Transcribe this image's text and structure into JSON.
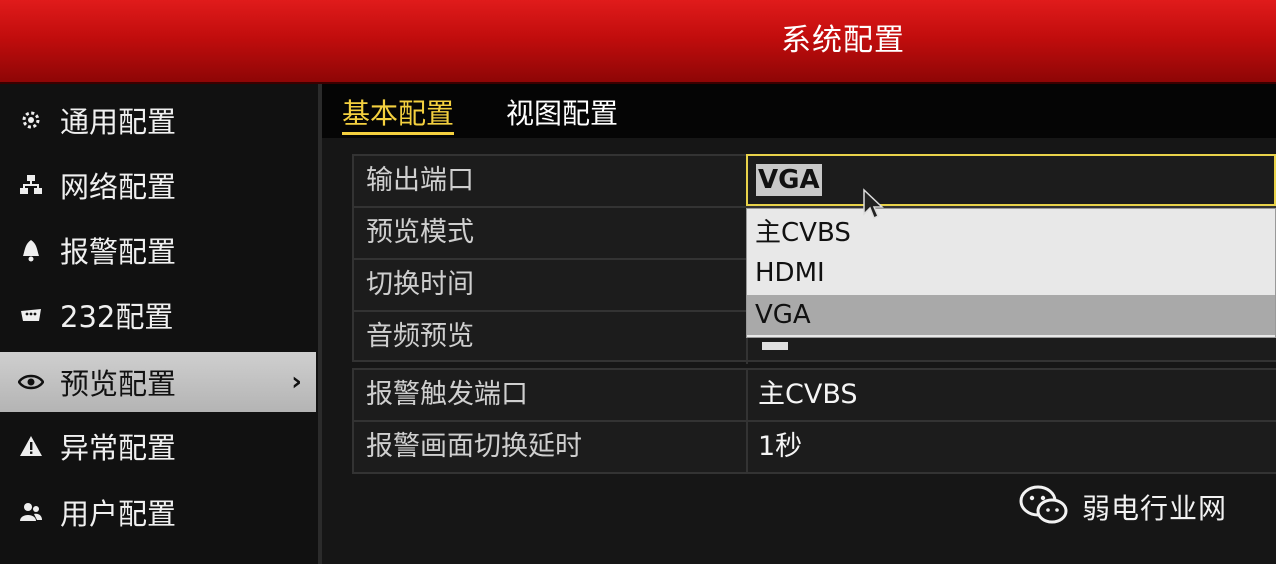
{
  "window": {
    "title": "系统配置"
  },
  "sidebar": {
    "items": [
      {
        "label": "通用配置",
        "icon": "gear-icon"
      },
      {
        "label": "网络配置",
        "icon": "network-icon"
      },
      {
        "label": "报警配置",
        "icon": "alarm-bell-icon"
      },
      {
        "label": "232配置",
        "icon": "serial-port-icon"
      },
      {
        "label": "预览配置",
        "icon": "eye-icon",
        "active": true,
        "arrow": "›"
      },
      {
        "label": "异常配置",
        "icon": "warning-icon"
      },
      {
        "label": "用户配置",
        "icon": "users-icon"
      }
    ]
  },
  "tabs": [
    {
      "label": "基本配置",
      "active": true
    },
    {
      "label": "视图配置",
      "active": false
    }
  ],
  "settings": {
    "rows": [
      {
        "label": "输出端口",
        "value": "VGA"
      },
      {
        "label": "预览模式",
        "value": ""
      },
      {
        "label": "切换时间",
        "value": ""
      },
      {
        "label": "音频预览",
        "value": ""
      }
    ],
    "rows2": [
      {
        "label": "报警触发端口",
        "value": "主CVBS"
      },
      {
        "label": "报警画面切换延时",
        "value": "1秒"
      }
    ]
  },
  "dropdown": {
    "options": [
      "主CVBS",
      "HDMI",
      "VGA"
    ],
    "highlighted": "VGA"
  },
  "watermark": {
    "text": "弱电行业网",
    "icon": "wechat-icon"
  },
  "colors": {
    "title_red": "#c20d0d",
    "tab_active": "#f4d03f",
    "focus_border": "#e8d24a",
    "sidebar_active_bg": "#bdbdbd"
  }
}
